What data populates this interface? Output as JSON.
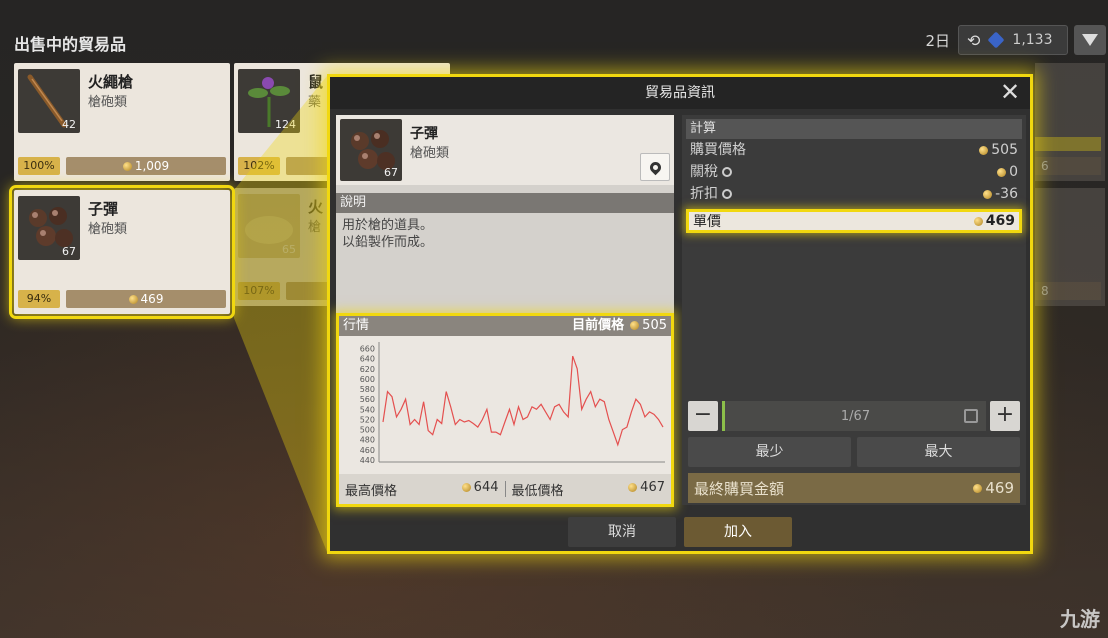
{
  "header": {
    "title": "出售中的貿易品",
    "day": "2日",
    "gems": "1,133"
  },
  "cards": [
    {
      "name": "火繩槍",
      "category": "槍砲類",
      "qty": "42",
      "pct": "100%",
      "price": "1,009"
    },
    {
      "name": "鼠",
      "category": "藥",
      "qty": "124",
      "pct": "102%",
      "price": ""
    },
    {
      "name": "子彈",
      "category": "槍砲類",
      "qty": "67",
      "pct": "94%",
      "price": "469"
    },
    {
      "name": "火",
      "category": "槍",
      "qty": "65",
      "pct": "107%",
      "price": ""
    }
  ],
  "side_values": {
    "a": "6",
    "b": "8"
  },
  "dialog": {
    "title": "貿易品資訊",
    "item": {
      "name": "子彈",
      "category": "槍砲類",
      "qty": "67"
    },
    "desc_label": "說明",
    "desc_text": "用於槍的道具。\n以鉛製作而成。",
    "market": {
      "label": "行情",
      "current_label": "目前價格",
      "current_value": "505",
      "high_label": "最高價格",
      "high_value": "644",
      "low_label": "最低價格",
      "low_value": "467"
    },
    "calc": {
      "label": "計算",
      "rows": [
        {
          "label": "購買價格",
          "value": "505"
        },
        {
          "label": "關稅",
          "value": "0"
        },
        {
          "label": "折扣",
          "value": "-36"
        }
      ],
      "unit_label": "單價",
      "unit_value": "469"
    },
    "quantity": "1/67",
    "min_label": "最少",
    "max_label": "最大",
    "final_label": "最終購買金額",
    "final_value": "469",
    "cancel_label": "取消",
    "add_label": "加入"
  },
  "watermark": "九游",
  "colors": {
    "highlight": "#f1d80f",
    "line": "#e4504f"
  },
  "chart_data": {
    "type": "line",
    "yticks": [
      660,
      640,
      620,
      600,
      580,
      560,
      540,
      520,
      500,
      480,
      460,
      440
    ],
    "ylim": [
      440,
      665
    ],
    "series": [
      {
        "values": [
          515,
          575,
          565,
          525,
          540,
          560,
          510,
          520,
          510,
          555,
          498,
          490,
          520,
          512,
          575,
          545,
          510,
          520,
          515,
          518,
          512,
          505,
          520,
          540,
          495,
          495,
          490,
          515,
          540,
          510,
          545,
          520,
          525,
          545,
          540,
          550,
          535,
          520,
          545,
          550,
          535,
          525,
          645,
          620,
          540,
          560,
          575,
          545,
          560,
          555,
          520,
          495,
          470,
          500,
          505,
          535,
          560,
          550,
          525,
          535,
          530,
          520,
          505
        ]
      }
    ]
  }
}
